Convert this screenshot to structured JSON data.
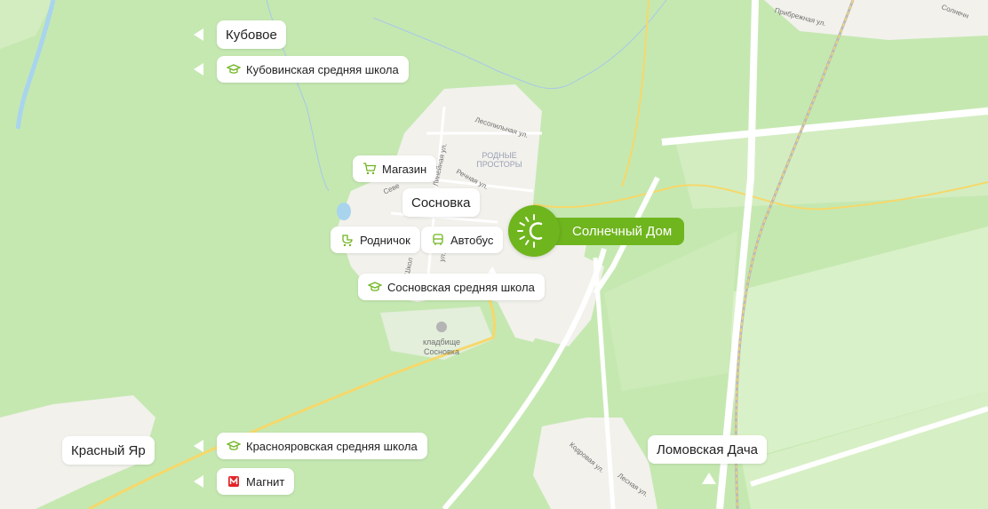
{
  "map": {
    "colors": {
      "forest": "#c5e8b1",
      "field": "#d9f1c8",
      "settlement": "#f2f1ec",
      "road": "#ffffff",
      "main_road": "#f6d86a",
      "water": "#a8d4ee",
      "railway": "#b9b9b9",
      "accent": "#6fb51e"
    }
  },
  "places": {
    "kubovoe": "Кубовое",
    "sosnovka": "Сосновка",
    "krasny_yar": "Красный Яр",
    "lomovskaya_dacha": "Ломовская Дача"
  },
  "pois": {
    "kubovo_school": {
      "label": "Кубовинская средняя школа",
      "icon": "graduation-cap-icon"
    },
    "magazin": {
      "label": "Магазин",
      "icon": "cart-icon"
    },
    "rodnichok": {
      "label": "Родничок",
      "icon": "stroller-icon"
    },
    "avtobus": {
      "label": "Автобус",
      "icon": "bus-icon"
    },
    "sosnovka_school": {
      "label": "Сосновская средняя школа",
      "icon": "graduation-cap-icon"
    },
    "krasnoyar_school": {
      "label": "Краснояровская средняя школа",
      "icon": "graduation-cap-icon"
    },
    "magnit": {
      "label": "Магнит",
      "icon": "magnit-icon"
    }
  },
  "highlight": {
    "label": "Солнечный Дом",
    "icon": "sun-logo-icon"
  },
  "small_labels": {
    "rodnye_prostory": "РОДНЫЕ\nПРОСТОРЫ",
    "cemetery": "кладбище\nСосновка",
    "pribrezhnaya": "Прибрежная ул.",
    "solnechnaya": "Солнечн",
    "lesopilnaya": "Лесопильная ул.",
    "lineynaya": "Линейная ул.",
    "rechnaya": "Речная ул.",
    "severnaya": "Севе",
    "shkolnaya": "Школ",
    "ul": "ул.",
    "kodrovaya": "Кодровая ул.",
    "lesnaya": "Лесная ул."
  }
}
